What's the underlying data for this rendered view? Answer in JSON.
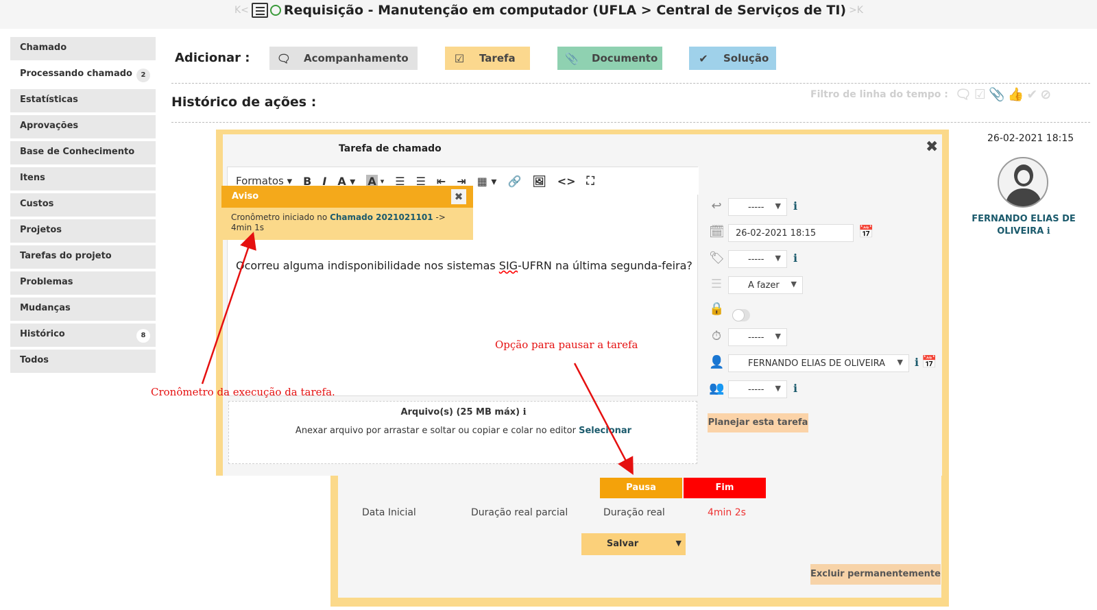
{
  "header": {
    "title": "Requisição - Manutenção em computador (UFLA > Central de Serviços de TI)",
    "nav_prev": "K<",
    "nav_next": ">K"
  },
  "sidebar": {
    "items": [
      {
        "label": "Chamado",
        "badge": ""
      },
      {
        "label": "Processando chamado",
        "badge": "2"
      },
      {
        "label": "Estatísticas",
        "badge": ""
      },
      {
        "label": "Aprovações",
        "badge": ""
      },
      {
        "label": "Base de Conhecimento",
        "badge": ""
      },
      {
        "label": "Itens",
        "badge": ""
      },
      {
        "label": "Custos",
        "badge": ""
      },
      {
        "label": "Projetos",
        "badge": ""
      },
      {
        "label": "Tarefas do projeto",
        "badge": ""
      },
      {
        "label": "Problemas",
        "badge": ""
      },
      {
        "label": "Mudanças",
        "badge": ""
      },
      {
        "label": "Histórico",
        "badge": "8"
      },
      {
        "label": "Todos",
        "badge": ""
      }
    ]
  },
  "add_bar": {
    "label": "Adicionar :",
    "buttons": {
      "followup": "Acompanhamento",
      "task": "Tarefa",
      "document": "Documento",
      "solution": "Solução"
    },
    "colors": {
      "followup": "#e2e2e2",
      "task": "#fbd88e",
      "document": "#8fd1b1",
      "solution": "#9fd1ea"
    }
  },
  "history": {
    "label": "Histórico de ações :",
    "filter_label": "Filtro de linha do tempo :"
  },
  "entry": {
    "date": "26-02-2021 18:15",
    "user_name": "FERNANDO ELIAS DE OLIVEIRA"
  },
  "task_modal": {
    "title": "Tarefa de chamado",
    "toolbar": {
      "formats": "Formatos"
    },
    "content": {
      "before": "Ocorreu alguma indisponibilidade nos sistemas ",
      "misspelled": "SIG",
      "after": "-UFRN na última segunda-feira?"
    },
    "attachments": {
      "title": "Arquivo(s) (25 MB máx)",
      "hint": "Anexar arquivo por arrastar e soltar ou copiar e colar no editor",
      "select_link": "Selecionar"
    },
    "fields": {
      "template": "-----",
      "date": "26-02-2021 18:15",
      "category": "-----",
      "status": "A fazer",
      "duration": "-----",
      "technician": "FERNANDO ELIAS DE OLIVEIRA",
      "group": "-----"
    },
    "plan_button": "Planejar esta tarefa",
    "pause_button": "Pausa",
    "end_button": "Fim",
    "labels": {
      "start_date": "Data Inicial",
      "partial_duration": "Duração real parcial",
      "real_duration": "Duração real"
    },
    "real_duration_value": "4min 2s",
    "save_button": "Salvar",
    "delete_button": "Excluir permanentemente"
  },
  "notice": {
    "title": "Aviso",
    "text_prefix": "Cronômetro iniciado no",
    "link": "Chamado 2021021101",
    "text_suffix": "-> 4min 1s"
  },
  "annotations": {
    "timer": "Cronômetro da execução da tarefa.",
    "pause": "Opção para pausar a tarefa",
    "color": "#e51010"
  }
}
